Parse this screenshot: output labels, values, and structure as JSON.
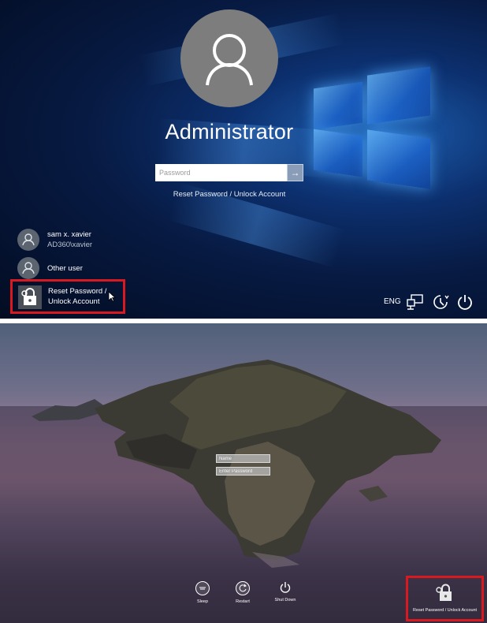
{
  "windows": {
    "user_name": "Administrator",
    "password_placeholder": "Password",
    "submit_glyph": "→",
    "reset_link": "Reset Password / Unlock Account",
    "users": [
      {
        "name": "sam x. xavier",
        "account": "AD360\\xavier"
      },
      {
        "name": "Other user",
        "account": ""
      }
    ],
    "reset_tile_line1": "Reset Password /",
    "reset_tile_line2": "Unlock Account",
    "language": "ENG",
    "icons": [
      "network-icon",
      "ease-of-access-icon",
      "power-icon"
    ],
    "highlight_color": "#d8191f"
  },
  "mac": {
    "name_placeholder": "Name",
    "password_placeholder": "Enter Password",
    "buttons": [
      {
        "label": "Sleep",
        "icon": "sleep-icon"
      },
      {
        "label": "Restart",
        "icon": "restart-icon"
      },
      {
        "label": "Shut Down",
        "icon": "shut-down-icon"
      }
    ],
    "reset_label": "Reset Password / Unlock Account",
    "highlight_color": "#d8191f"
  }
}
